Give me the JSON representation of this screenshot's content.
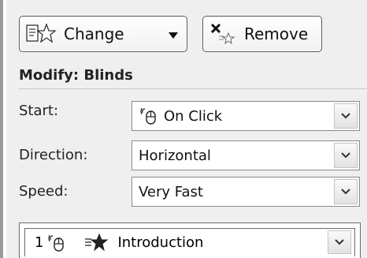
{
  "toolbar": {
    "change_label": "Change",
    "remove_label": "Remove"
  },
  "section": {
    "heading": "Modify: Blinds"
  },
  "fields": {
    "start": {
      "label": "Start:",
      "value": "On Click"
    },
    "direction": {
      "label": "Direction:",
      "value": "Horizontal"
    },
    "speed": {
      "label": "Speed:",
      "value": "Very Fast"
    }
  },
  "animation_list": {
    "items": [
      {
        "number": "1",
        "name": "Introduction"
      }
    ]
  },
  "icons": {
    "change": "add-effect-star-icon",
    "remove": "remove-effect-icon",
    "start_trigger": "mouse-icon",
    "dropdown": "chevron-down-icon",
    "effect": "entrance-effect-star-icon"
  },
  "colors": {
    "panel_bg": "#efefef",
    "left_strip": "#9a9a9a",
    "text": "#222222"
  }
}
